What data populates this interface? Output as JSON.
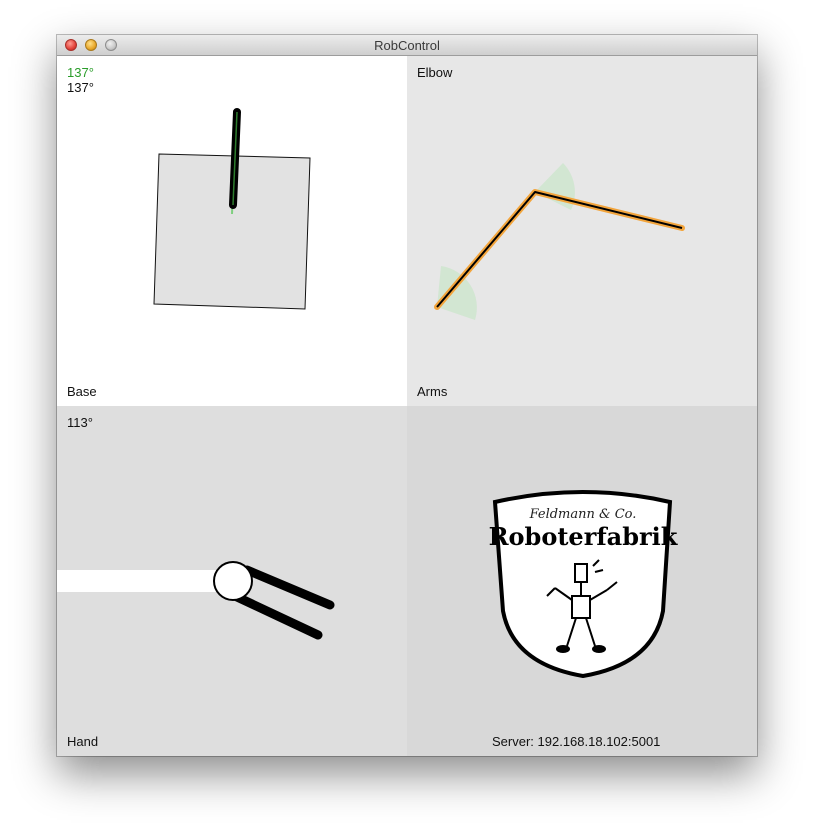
{
  "window": {
    "title": "RobControl"
  },
  "base": {
    "target_angle": "137°",
    "current_angle": "137°",
    "label": "Base",
    "target_color": "#2a9d2a"
  },
  "arms": {
    "top_label": "Elbow",
    "label": "Arms",
    "arm_color": "#f3a53c"
  },
  "hand": {
    "angle": "113°",
    "label": "Hand"
  },
  "logo": {
    "script_line": "Feldmann & Co.",
    "brand": "Roboterfabrik",
    "server": "Server: 192.168.18.102:5001"
  }
}
